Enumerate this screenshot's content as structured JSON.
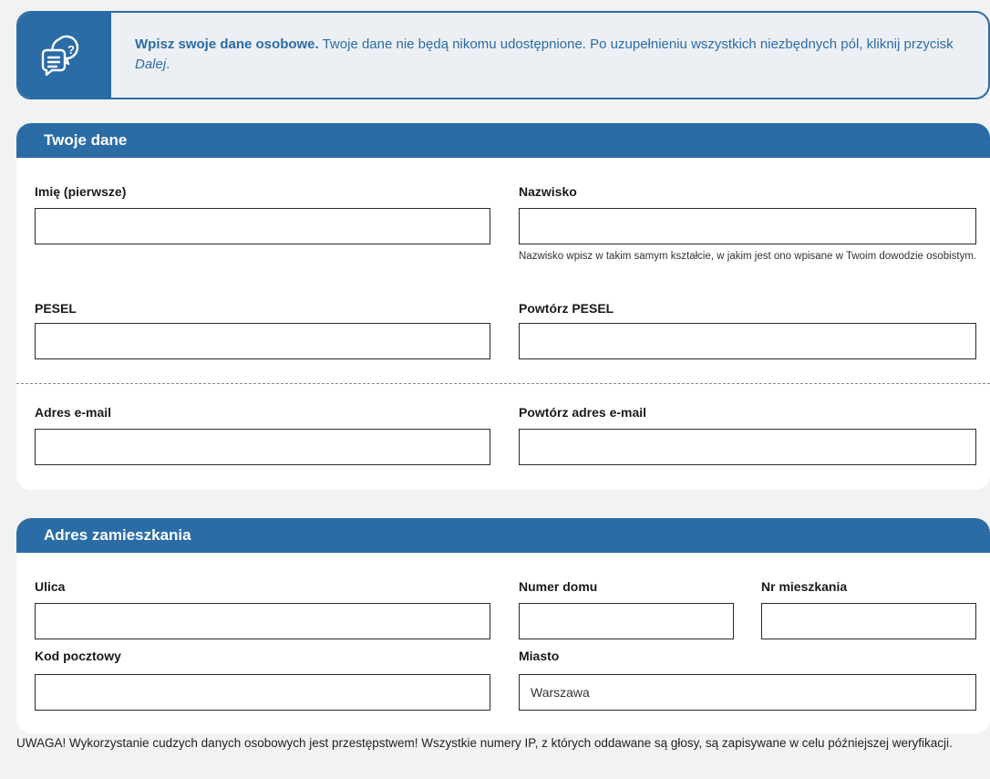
{
  "info": {
    "bold": "Wpisz swoje dane osobowe.",
    "text_before_italic": " Twoje dane nie będą nikomu udostępnione. Po uzupełnieniu wszystkich niezbędnych pól, kliknij przycisk ",
    "italic": "Dalej",
    "text_after_italic": ".",
    "icon": "chat-question-icon"
  },
  "personal": {
    "title": "Twoje dane",
    "first_name": {
      "label": "Imię (pierwsze)",
      "value": ""
    },
    "last_name": {
      "label": "Nazwisko",
      "value": "",
      "hint": "Nazwisko wpisz w takim samym kształcie, w jakim jest ono wpisane w Twoim dowodzie osobistym."
    },
    "pesel": {
      "label": "PESEL",
      "value": ""
    },
    "pesel_repeat": {
      "label": "Powtórz PESEL",
      "value": ""
    },
    "email": {
      "label": "Adres e-mail",
      "value": ""
    },
    "email_repeat": {
      "label": "Powtórz adres e-mail",
      "value": ""
    }
  },
  "address": {
    "title": "Adres zamieszkania",
    "street": {
      "label": "Ulica",
      "value": ""
    },
    "house_number": {
      "label": "Numer domu",
      "value": ""
    },
    "apartment": {
      "label": "Nr mieszkania",
      "value": ""
    },
    "postal_code": {
      "label": "Kod pocztowy",
      "value": ""
    },
    "city": {
      "label": "Miasto",
      "value": "Warszawa"
    }
  },
  "warning": "UWAGA! Wykorzystanie cudzych danych osobowych jest przestępstwem! Wszystkie numery IP, z których oddawane są głosy, są zapisywane w celu późniejszej weryfikacji.",
  "colors": {
    "accent": "#2b6ca6",
    "background": "#f2f2f2",
    "banner_bg": "#ecf0f4"
  }
}
